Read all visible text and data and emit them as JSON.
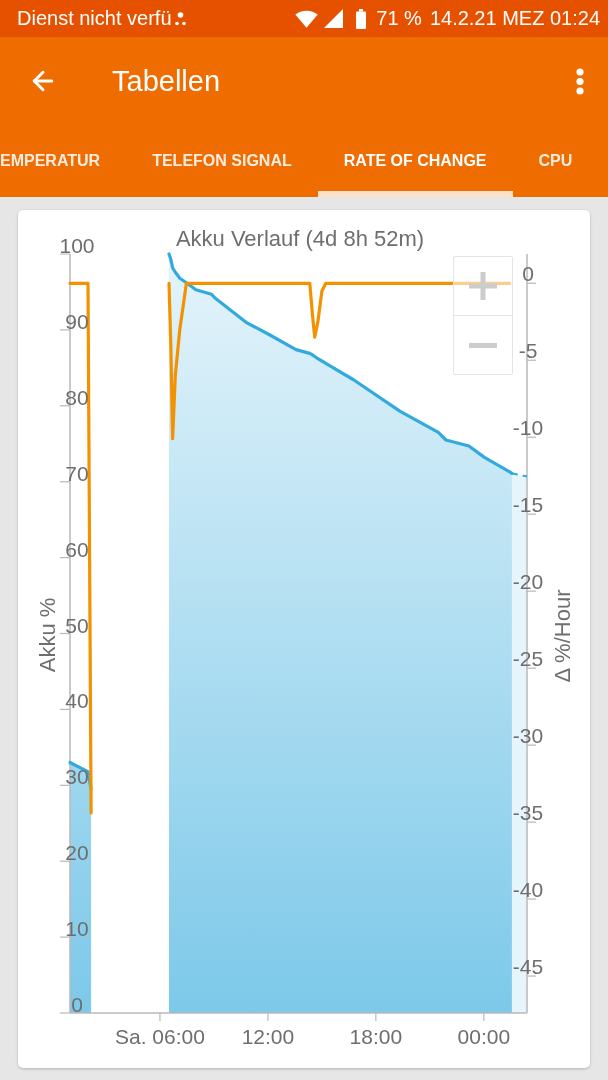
{
  "status_bar": {
    "carrier": "Dienst nicht verfü",
    "battery": "71 %",
    "datetime": "14.2.21 MEZ 01:24"
  },
  "toolbar": {
    "title": "Tabellen"
  },
  "tabs": [
    {
      "label": "EMPERATUR",
      "selected": false
    },
    {
      "label": "TELEFON SIGNAL",
      "selected": false
    },
    {
      "label": "RATE OF CHANGE",
      "selected": true
    },
    {
      "label": "CPU",
      "selected": false
    }
  ],
  "card": {
    "chart_data": {
      "type": "line",
      "title": "Akku Verlauf (4d 8h 52m)",
      "ylabel": "Akku %",
      "y2label": "Δ %/Hour",
      "xlim": [
        1.0,
        26.4
      ],
      "ylim": [
        0,
        100
      ],
      "y2lim": [
        -47.4,
        1.9
      ],
      "xticks": [
        {
          "value": 6,
          "label": "Sa. 06:00"
        },
        {
          "value": 12,
          "label": "12:00"
        },
        {
          "value": 18,
          "label": "18:00"
        },
        {
          "value": 24,
          "label": "00:00"
        }
      ],
      "yticks": [
        0,
        10,
        20,
        30,
        40,
        50,
        60,
        70,
        80,
        90,
        100
      ],
      "y2ticks": [
        0,
        -5,
        -10,
        -15,
        -20,
        -25,
        -30,
        -35,
        -40,
        -45
      ],
      "x": [
        1.0,
        2.0,
        2.17,
        6.5,
        6.6,
        6.7,
        6.85,
        7.1,
        7.47,
        8.0,
        8.86,
        9.06,
        10.78,
        12.06,
        13.56,
        14.33,
        14.47,
        14.6,
        14.78,
        15.0,
        15.22,
        16.78,
        19.33,
        21.47,
        21.89,
        23.17,
        24.03,
        25.44,
        25.56,
        26.4
      ],
      "series": [
        {
          "type": "area",
          "color": "#33aadd",
          "values": [
            33,
            31.8,
            29.5,
            null,
            null,
            null,
            null,
            null,
            null,
            null,
            null,
            null,
            null,
            null,
            null,
            null,
            null,
            null,
            null,
            null,
            null,
            null,
            null,
            null,
            null,
            null,
            null,
            null,
            null,
            null
          ]
        },
        {
          "type": "area",
          "color": "#33aadd",
          "values": [
            null,
            null,
            null,
            100,
            99.3,
            98.2,
            97.6,
            96.8,
            96.2,
            95.3,
            94.7,
            94.2,
            91.0,
            89.4,
            87.4,
            86.9,
            86.7,
            86.5,
            86.2,
            85.9,
            85.6,
            83.4,
            79.3,
            76.5,
            75.5,
            74.7,
            73.2,
            71.3,
            71.1,
            null
          ]
        },
        {
          "type": "area",
          "color": "#33aadd",
          "values": [
            null,
            null,
            null,
            null,
            null,
            null,
            null,
            null,
            null,
            null,
            null,
            null,
            null,
            null,
            null,
            null,
            null,
            null,
            null,
            null,
            null,
            null,
            null,
            null,
            null,
            null,
            null,
            null,
            71.1,
            70.7
          ]
        },
        {
          "type": "line",
          "axis": "y2",
          "color": "#f39200",
          "values": [
            0,
            0,
            -34.4,
            null,
            null,
            null,
            null,
            null,
            null,
            null,
            null,
            null,
            null,
            null,
            null,
            null,
            null,
            null,
            null,
            null,
            null,
            null,
            null,
            null,
            null,
            null,
            null,
            null,
            null,
            null
          ]
        },
        {
          "type": "line",
          "axis": "y2",
          "color": "#f39200",
          "values": [
            null,
            null,
            null,
            0,
            -4,
            -10.1,
            -6,
            -3,
            0,
            0,
            0,
            0,
            0,
            0,
            0,
            0,
            -2,
            -3.5,
            -2.5,
            -0.5,
            0,
            0,
            0,
            0,
            0,
            0,
            0,
            0,
            null,
            null
          ]
        }
      ]
    }
  }
}
